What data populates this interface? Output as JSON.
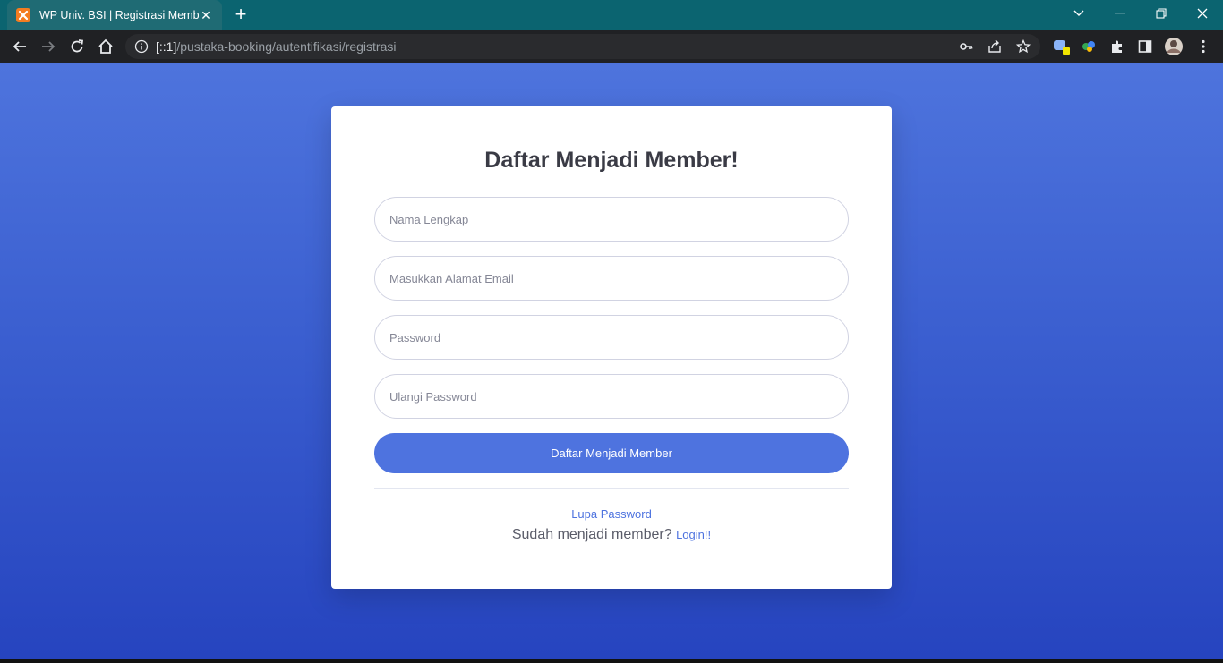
{
  "browser": {
    "tab_title": "WP Univ. BSI | Registrasi Member",
    "url_host": "[::1]",
    "url_path": "/pustaka-booking/autentifikasi/registrasi",
    "theme_color": "#0b6470"
  },
  "form": {
    "title": "Daftar Menjadi Member!",
    "name_placeholder": "Nama Lengkap",
    "email_placeholder": "Masukkan Alamat Email",
    "password_placeholder": "Password",
    "confirm_placeholder": "Ulangi Password",
    "submit_label": "Daftar Menjadi Member",
    "forgot_label": "Lupa Password",
    "already_text": "Sudah menjadi member?",
    "login_label": "Login!!",
    "accent_color": "#4e73df"
  }
}
